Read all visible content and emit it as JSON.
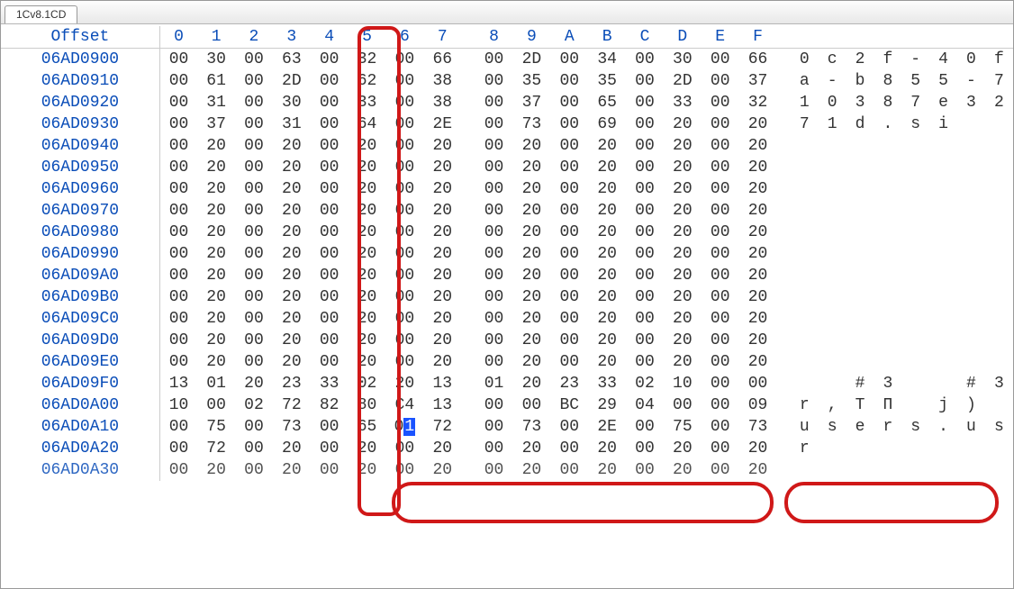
{
  "tab": {
    "label": "1Cv8.1CD"
  },
  "header": {
    "offset_label": "Offset",
    "cols": [
      "0",
      "1",
      "2",
      "3",
      "4",
      "5",
      "6",
      "7",
      "8",
      "9",
      "A",
      "B",
      "C",
      "D",
      "E",
      "F"
    ]
  },
  "rows": [
    {
      "offset": "06AD0900",
      "hex": [
        "00",
        "30",
        "00",
        "63",
        "00",
        "32",
        "00",
        "66",
        "00",
        "2D",
        "00",
        "34",
        "00",
        "30",
        "00",
        "66"
      ],
      "ascii": [
        "0",
        "c",
        "2",
        "f",
        "-",
        "4",
        "0",
        "f"
      ]
    },
    {
      "offset": "06AD0910",
      "hex": [
        "00",
        "61",
        "00",
        "2D",
        "00",
        "62",
        "00",
        "38",
        "00",
        "35",
        "00",
        "35",
        "00",
        "2D",
        "00",
        "37"
      ],
      "ascii": [
        "a",
        "-",
        "b",
        "8",
        "5",
        "5",
        "-",
        "7"
      ]
    },
    {
      "offset": "06AD0920",
      "hex": [
        "00",
        "31",
        "00",
        "30",
        "00",
        "33",
        "00",
        "38",
        "00",
        "37",
        "00",
        "65",
        "00",
        "33",
        "00",
        "32"
      ],
      "ascii": [
        "1",
        "0",
        "3",
        "8",
        "7",
        "e",
        "3",
        "2"
      ]
    },
    {
      "offset": "06AD0930",
      "hex": [
        "00",
        "37",
        "00",
        "31",
        "00",
        "64",
        "00",
        "2E",
        "00",
        "73",
        "00",
        "69",
        "00",
        "20",
        "00",
        "20"
      ],
      "ascii": [
        "7",
        "1",
        "d",
        ".",
        "s",
        "i",
        " ",
        " "
      ]
    },
    {
      "offset": "06AD0940",
      "hex": [
        "00",
        "20",
        "00",
        "20",
        "00",
        "20",
        "00",
        "20",
        "00",
        "20",
        "00",
        "20",
        "00",
        "20",
        "00",
        "20"
      ],
      "ascii": [
        " ",
        " ",
        " ",
        " ",
        " ",
        " ",
        " ",
        " "
      ]
    },
    {
      "offset": "06AD0950",
      "hex": [
        "00",
        "20",
        "00",
        "20",
        "00",
        "20",
        "00",
        "20",
        "00",
        "20",
        "00",
        "20",
        "00",
        "20",
        "00",
        "20"
      ],
      "ascii": [
        " ",
        " ",
        " ",
        " ",
        " ",
        " ",
        " ",
        " "
      ]
    },
    {
      "offset": "06AD0960",
      "hex": [
        "00",
        "20",
        "00",
        "20",
        "00",
        "20",
        "00",
        "20",
        "00",
        "20",
        "00",
        "20",
        "00",
        "20",
        "00",
        "20"
      ],
      "ascii": [
        " ",
        " ",
        " ",
        " ",
        " ",
        " ",
        " ",
        " "
      ]
    },
    {
      "offset": "06AD0970",
      "hex": [
        "00",
        "20",
        "00",
        "20",
        "00",
        "20",
        "00",
        "20",
        "00",
        "20",
        "00",
        "20",
        "00",
        "20",
        "00",
        "20"
      ],
      "ascii": [
        " ",
        " ",
        " ",
        " ",
        " ",
        " ",
        " ",
        " "
      ]
    },
    {
      "offset": "06AD0980",
      "hex": [
        "00",
        "20",
        "00",
        "20",
        "00",
        "20",
        "00",
        "20",
        "00",
        "20",
        "00",
        "20",
        "00",
        "20",
        "00",
        "20"
      ],
      "ascii": [
        " ",
        " ",
        " ",
        " ",
        " ",
        " ",
        " ",
        " "
      ]
    },
    {
      "offset": "06AD0990",
      "hex": [
        "00",
        "20",
        "00",
        "20",
        "00",
        "20",
        "00",
        "20",
        "00",
        "20",
        "00",
        "20",
        "00",
        "20",
        "00",
        "20"
      ],
      "ascii": [
        " ",
        " ",
        " ",
        " ",
        " ",
        " ",
        " ",
        " "
      ]
    },
    {
      "offset": "06AD09A0",
      "hex": [
        "00",
        "20",
        "00",
        "20",
        "00",
        "20",
        "00",
        "20",
        "00",
        "20",
        "00",
        "20",
        "00",
        "20",
        "00",
        "20"
      ],
      "ascii": [
        " ",
        " ",
        " ",
        " ",
        " ",
        " ",
        " ",
        " "
      ]
    },
    {
      "offset": "06AD09B0",
      "hex": [
        "00",
        "20",
        "00",
        "20",
        "00",
        "20",
        "00",
        "20",
        "00",
        "20",
        "00",
        "20",
        "00",
        "20",
        "00",
        "20"
      ],
      "ascii": [
        " ",
        " ",
        " ",
        " ",
        " ",
        " ",
        " ",
        " "
      ]
    },
    {
      "offset": "06AD09C0",
      "hex": [
        "00",
        "20",
        "00",
        "20",
        "00",
        "20",
        "00",
        "20",
        "00",
        "20",
        "00",
        "20",
        "00",
        "20",
        "00",
        "20"
      ],
      "ascii": [
        " ",
        " ",
        " ",
        " ",
        " ",
        " ",
        " ",
        " "
      ]
    },
    {
      "offset": "06AD09D0",
      "hex": [
        "00",
        "20",
        "00",
        "20",
        "00",
        "20",
        "00",
        "20",
        "00",
        "20",
        "00",
        "20",
        "00",
        "20",
        "00",
        "20"
      ],
      "ascii": [
        " ",
        " ",
        " ",
        " ",
        " ",
        " ",
        " ",
        " "
      ]
    },
    {
      "offset": "06AD09E0",
      "hex": [
        "00",
        "20",
        "00",
        "20",
        "00",
        "20",
        "00",
        "20",
        "00",
        "20",
        "00",
        "20",
        "00",
        "20",
        "00",
        "20"
      ],
      "ascii": [
        " ",
        " ",
        " ",
        " ",
        " ",
        " ",
        " ",
        " "
      ]
    },
    {
      "offset": "06AD09F0",
      "hex": [
        "13",
        "01",
        "20",
        "23",
        "33",
        "02",
        "20",
        "13",
        "01",
        "20",
        "23",
        "33",
        "02",
        "10",
        "00",
        "00"
      ],
      "ascii": [
        " ",
        " ",
        "#",
        "3",
        " ",
        " ",
        "#",
        "3"
      ]
    },
    {
      "offset": "06AD0A00",
      "hex": [
        "10",
        "00",
        "02",
        "72",
        "82",
        "80",
        "C4",
        "13",
        "00",
        "00",
        "BC",
        "29",
        "04",
        "00",
        "00",
        "09"
      ],
      "ascii": [
        "r",
        ",",
        "Т",
        "П",
        " ",
        "j",
        ")",
        " "
      ],
      "obscured": true
    },
    {
      "offset": "06AD0A10",
      "hex": [
        "00",
        "75",
        "00",
        "73",
        "00",
        "65",
        "01",
        "72",
        "00",
        "73",
        "00",
        "2E",
        "00",
        "75",
        "00",
        "73"
      ],
      "ascii": [
        "u",
        "s",
        "e",
        "r",
        "s",
        ".",
        "u",
        "s"
      ],
      "highlight": true,
      "sel_index": 6
    },
    {
      "offset": "06AD0A20",
      "hex": [
        "00",
        "72",
        "00",
        "20",
        "00",
        "20",
        "00",
        "20",
        "00",
        "20",
        "00",
        "20",
        "00",
        "20",
        "00",
        "20"
      ],
      "ascii": [
        "r",
        " ",
        " ",
        " ",
        " ",
        " ",
        " ",
        " "
      ],
      "obscured": true
    },
    {
      "offset": "06AD0A30",
      "hex": [
        "00",
        "20",
        "00",
        "20",
        "00",
        "20",
        "00",
        "20",
        "00",
        "20",
        "00",
        "20",
        "00",
        "20",
        "00",
        "20"
      ],
      "ascii": [
        " ",
        " ",
        " ",
        " ",
        " ",
        " ",
        " ",
        " "
      ],
      "half": true
    }
  ]
}
